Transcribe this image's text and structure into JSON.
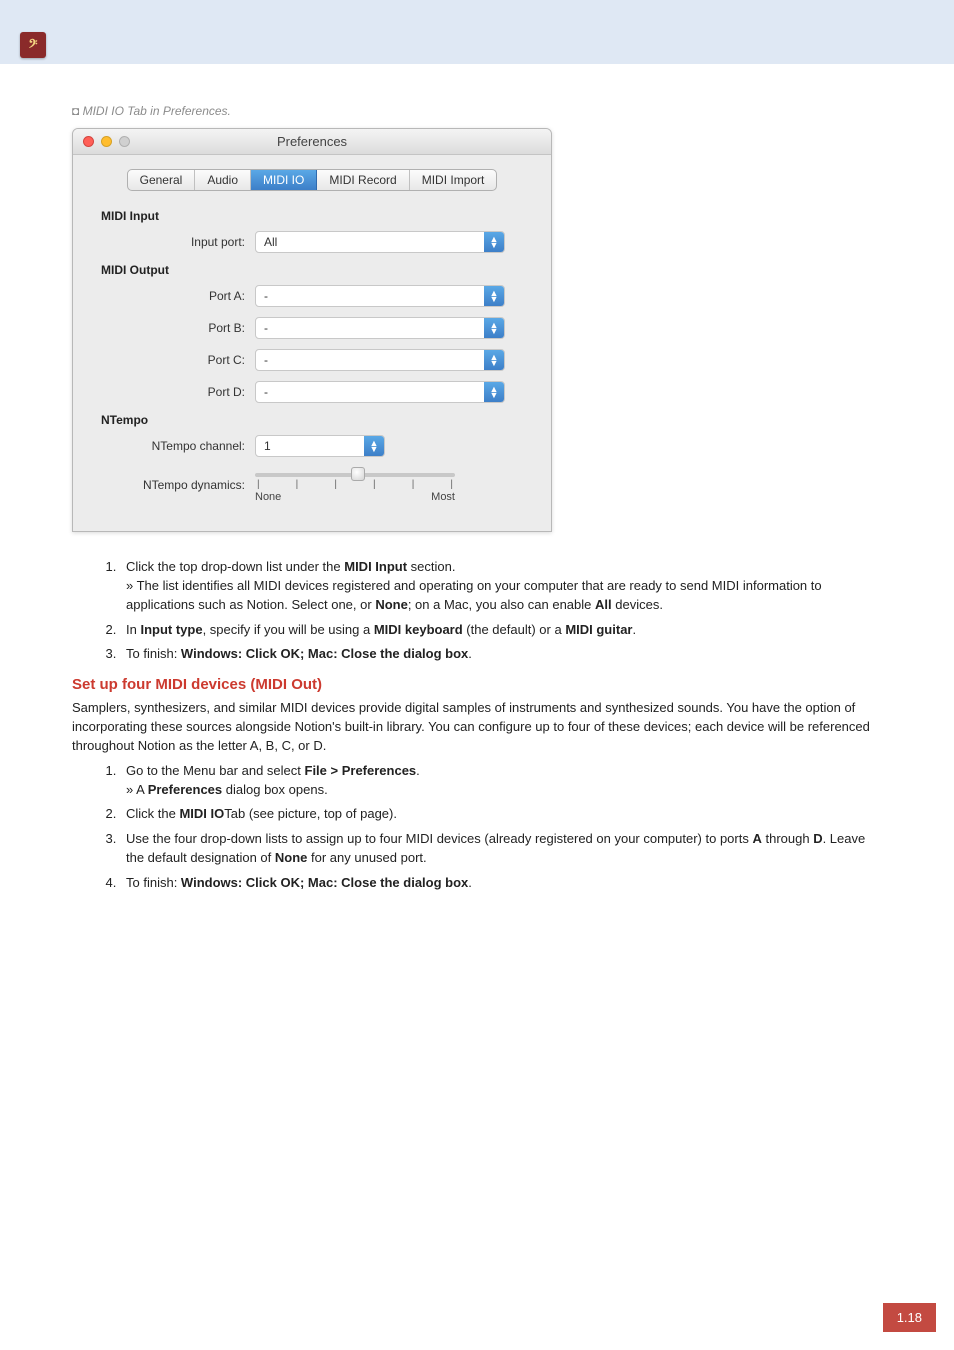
{
  "logo_glyph": "𝄢",
  "caption": "MIDI IO Tab in Preferences.",
  "window": {
    "title": "Preferences",
    "tabs": [
      "General",
      "Audio",
      "MIDI IO",
      "MIDI Record",
      "MIDI Import"
    ],
    "active_tab_index": 2,
    "sections": {
      "midi_input": {
        "heading": "MIDI Input",
        "input_port_label": "Input port:",
        "input_port_value": "All"
      },
      "midi_output": {
        "heading": "MIDI Output",
        "ports": [
          {
            "label": "Port A:",
            "value": "-"
          },
          {
            "label": "Port B:",
            "value": "-"
          },
          {
            "label": "Port C:",
            "value": "-"
          },
          {
            "label": "Port D:",
            "value": "-"
          }
        ]
      },
      "ntempo": {
        "heading": "NTempo",
        "channel_label": "NTempo channel:",
        "channel_value": "1",
        "dynamics_label": "NTempo dynamics:",
        "slider_min_label": "None",
        "slider_max_label": "Most"
      }
    }
  },
  "list1": {
    "i1_a": "Click the top drop-down list under the ",
    "i1_b": "MIDI Input",
    "i1_c": " section.",
    "i1_sub_a": "» The list identifies all MIDI devices registered and operating on your computer that are ready to send MIDI information to applications such as Notion. Select one, or ",
    "i1_sub_b": "None",
    "i1_sub_c": "; on a Mac, you also can enable ",
    "i1_sub_d": "All",
    "i1_sub_e": " devices.",
    "i2_a": "In ",
    "i2_b": "Input type",
    "i2_c": ", specify if you will be using a ",
    "i2_d": "MIDI keyboard",
    "i2_e": " (the default) or a ",
    "i2_f": "MIDI guitar",
    "i2_g": ".",
    "i3_a": "To finish: ",
    "i3_b": "Windows: Click OK; Mac: Close the dialog box",
    "i3_c": "."
  },
  "section2_heading": "Set up four MIDI devices (MIDI Out)",
  "section2_para": "Samplers, synthesizers, and similar MIDI devices provide digital samples of instruments and synthesized sounds. You have the option of incorporating these sources alongside Notion's built-in library. You can configure up to four of these devices; each device will be referenced throughout Notion as the letter A, B, C, or D.",
  "list2": {
    "i1_a": "Go to the Menu bar and select ",
    "i1_b": "File > Preferences",
    "i1_c": ".",
    "i1_sub_a": "» A ",
    "i1_sub_b": "Preferences",
    "i1_sub_c": " dialog box opens.",
    "i2_a": "Click the ",
    "i2_b": "MIDI IO",
    "i2_c": "Tab (see picture, top of page).",
    "i3_a": "Use the four drop-down lists to assign up to four MIDI devices (already registered on your computer) to ports ",
    "i3_b": "A",
    "i3_c": " through ",
    "i3_d": "D",
    "i3_e": ". Leave the default designation of ",
    "i3_f": "None",
    "i3_g": " for any unused port.",
    "i4_a": "To finish: ",
    "i4_b": "Windows: Click OK; Mac: Close the dialog box",
    "i4_c": "."
  },
  "page_number": "1.18"
}
